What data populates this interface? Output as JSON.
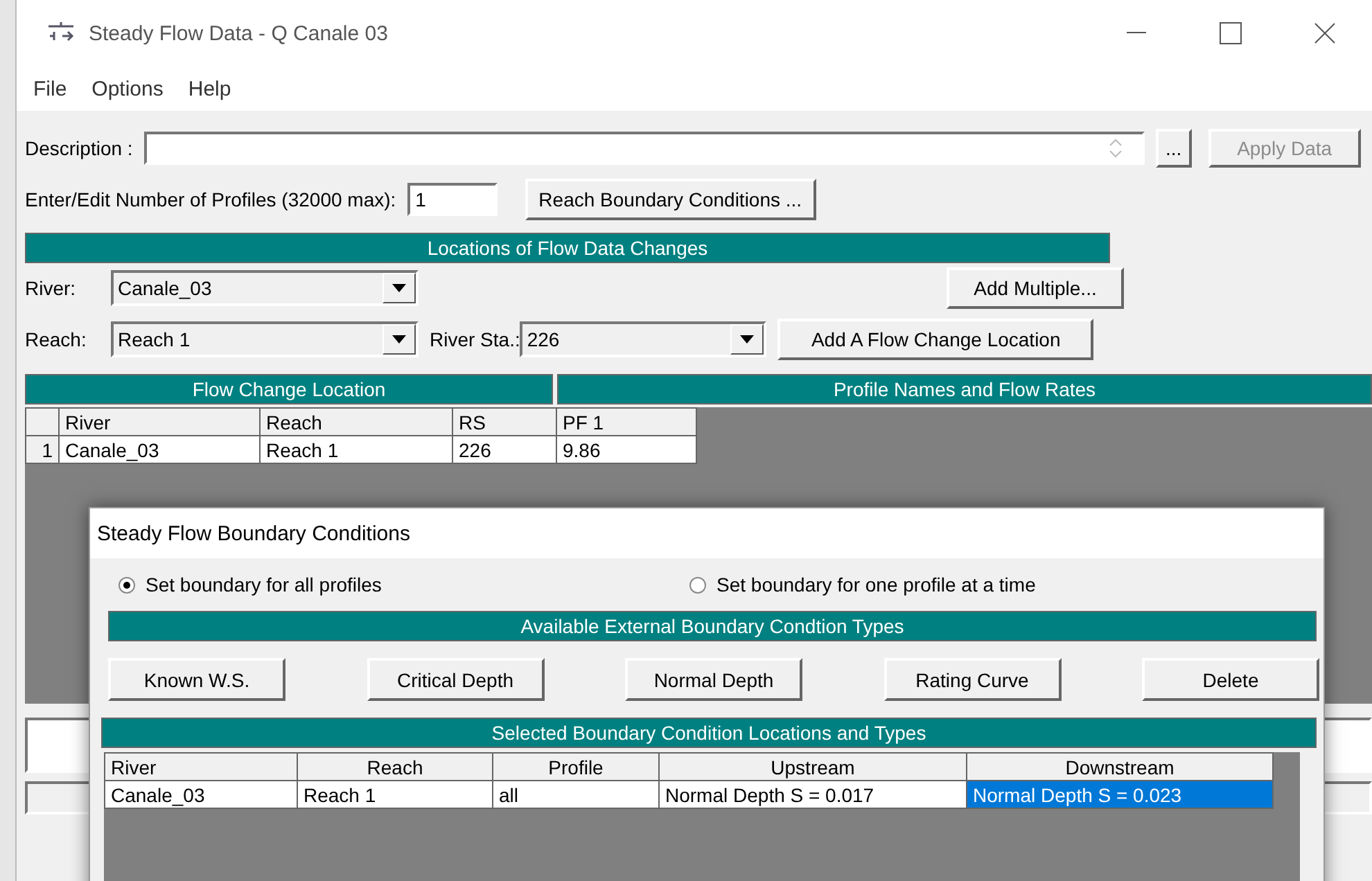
{
  "window": {
    "title": "Steady Flow Data - Q Canale 03"
  },
  "menu": [
    {
      "label": "File"
    },
    {
      "label": "Options"
    },
    {
      "label": "Help"
    }
  ],
  "description": {
    "label": "Description :",
    "more_button": "...",
    "apply_button": {
      "label": "Apply Data",
      "disabled": true
    }
  },
  "profiles": {
    "label": "Enter/Edit Number of Profiles (32000 max):",
    "value": "1",
    "button": "Reach Boundary Conditions ..."
  },
  "locations": {
    "title": "Locations of Flow Data Changes",
    "river": {
      "label": "River:",
      "value": "Canale_03"
    },
    "reach": {
      "label": "Reach:",
      "value": "Reach 1"
    },
    "river_station": {
      "label": "River Sta.:",
      "value": "226"
    },
    "add_multiple_button": "Add Multiple...",
    "add_location_button": "Add A Flow Change Location"
  },
  "flow_table": {
    "left_title": "Flow Change Location",
    "right_title": "Profile Names and Flow Rates",
    "columns": [
      "River",
      "Reach",
      "RS",
      "PF 1"
    ],
    "rows": [
      {
        "index": "1",
        "cells": [
          "Canale_03",
          "Reach 1",
          "226",
          "9.86"
        ]
      }
    ]
  },
  "dialog": {
    "title": "Steady Flow Boundary Conditions",
    "radios": [
      {
        "label": "Set boundary for all profiles",
        "selected": true
      },
      {
        "label": "Set boundary for one profile at a time",
        "selected": false
      }
    ],
    "types_title": "Available External Boundary Condtion Types",
    "type_buttons": [
      "Known W.S.",
      "Critical Depth",
      "Normal Depth",
      "Rating Curve",
      "Delete"
    ],
    "selected_title": "Selected Boundary Condition Locations and Types",
    "table": {
      "columns": [
        "River",
        "Reach",
        "Profile",
        "Upstream",
        "Downstream"
      ],
      "rows": [
        {
          "cells": [
            {
              "text": "Canale_03",
              "selected": false
            },
            {
              "text": "Reach 1",
              "selected": false
            },
            {
              "text": "all",
              "selected": false
            },
            {
              "text": "Normal Depth S = 0.017",
              "selected": false
            },
            {
              "text": "Normal Depth S = 0.023",
              "selected": true
            }
          ]
        }
      ]
    }
  }
}
